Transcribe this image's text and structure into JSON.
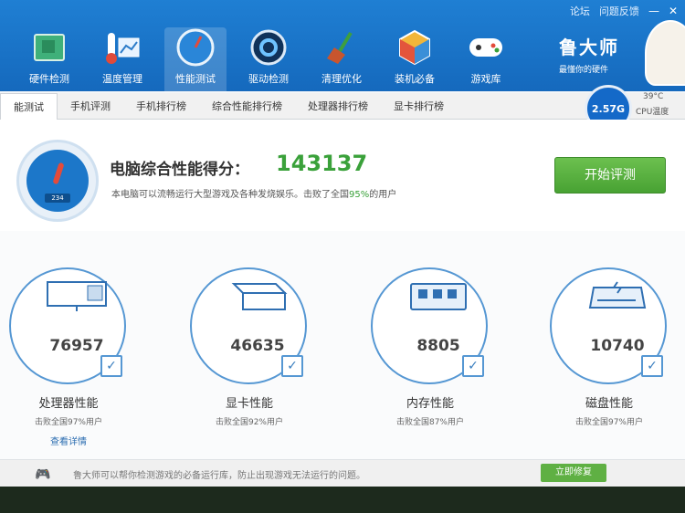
{
  "top_links": {
    "forum": "论坛",
    "feedback": "问题反馈",
    "min_icon": "—",
    "close_icon": "✕"
  },
  "nav": {
    "items": [
      {
        "label": "硬件检测",
        "icon": "motherboard-icon"
      },
      {
        "label": "温度管理",
        "icon": "thermometer-icon"
      },
      {
        "label": "性能测试",
        "icon": "gauge-icon"
      },
      {
        "label": "驱动检测",
        "icon": "gear-icon"
      },
      {
        "label": "清理优化",
        "icon": "broom-icon"
      },
      {
        "label": "装机必备",
        "icon": "cube-icon"
      },
      {
        "label": "游戏库",
        "icon": "gamepad-icon"
      }
    ]
  },
  "brand": {
    "name": "鲁大师",
    "slogan": "最懂你的硬件"
  },
  "tabs": [
    {
      "label": "能测试"
    },
    {
      "label": "手机评测"
    },
    {
      "label": "手机排行榜"
    },
    {
      "label": "综合性能排行榜"
    },
    {
      "label": "处理器排行榜"
    },
    {
      "label": "显卡排行榜"
    }
  ],
  "cpu_temp": {
    "speed": "2.57",
    "unit": "G",
    "temp": "39°C",
    "label": "CPU温度"
  },
  "score": {
    "title": "电脑综合性能得分：",
    "value": "143137",
    "desc_prefix": "本电脑可以流畅运行大型游戏及各种发烧娱乐。击败了全国",
    "desc_pct": "95%",
    "desc_suffix": "的用户",
    "gauge_reading": "234"
  },
  "start_button": "开始评测",
  "metrics": [
    {
      "value": "76957",
      "label": "处理器性能",
      "sub": "击败全国97%用户",
      "detail": "查看详情"
    },
    {
      "value": "46635",
      "label": "显卡性能",
      "sub": "击败全国92%用户",
      "detail": ""
    },
    {
      "value": "8805",
      "label": "内存性能",
      "sub": "击败全国87%用户",
      "detail": ""
    },
    {
      "value": "10740",
      "label": "磁盘性能",
      "sub": "击败全国97%用户",
      "detail": ""
    }
  ],
  "bottom": {
    "message": "鲁大师可以帮你检测游戏的必备运行库，防止出现游戏无法运行的问题。",
    "button": "立即修复"
  },
  "colors": {
    "header": "#1f7fd3",
    "accent_green": "#3aa13a",
    "ring": "#5597d3"
  }
}
